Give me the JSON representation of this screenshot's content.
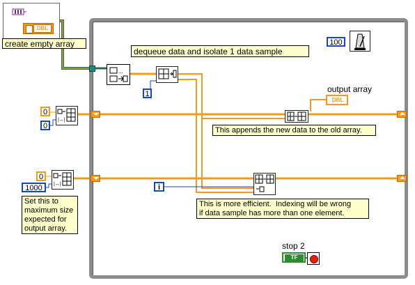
{
  "comments": {
    "create_empty_array": "create empty array",
    "dequeue": "dequeue data and isolate 1 data sample",
    "appends": "This appends the new data to the old array.",
    "efficient": "This is more efficient.  Indexing will be wrong\nif data sample has more than one element.",
    "set_max": "Set this to\nmaximum size\nexpected for\noutput array."
  },
  "constants": {
    "wait_ms": "100",
    "index_one": "1",
    "init_zero_top": "0",
    "init_zero_top_dim": "0",
    "init_zero_bottom": "0",
    "max_size": "1000",
    "loop_iteration": "i"
  },
  "labels": {
    "output_array": "output array",
    "stop": "stop 2",
    "dbl_type": "DBL",
    "tf": "TF"
  },
  "colors": {
    "loop_border": "#8c8c8c",
    "wire_orange": "#f39a1a",
    "wire_blue": "#1446c8",
    "comment_bg": "#ffffcc"
  },
  "icons": {
    "queue_refnum": "queue-refnum-icon",
    "dequeue": "dequeue-element-icon",
    "index_array": "index-array-icon",
    "initialize_array": "initialize-array-icon",
    "build_array": "build-array-icon",
    "replace_subset": "replace-array-subset-icon",
    "wait": "metronome-wait-icon",
    "stop": "stop-button-icon"
  }
}
